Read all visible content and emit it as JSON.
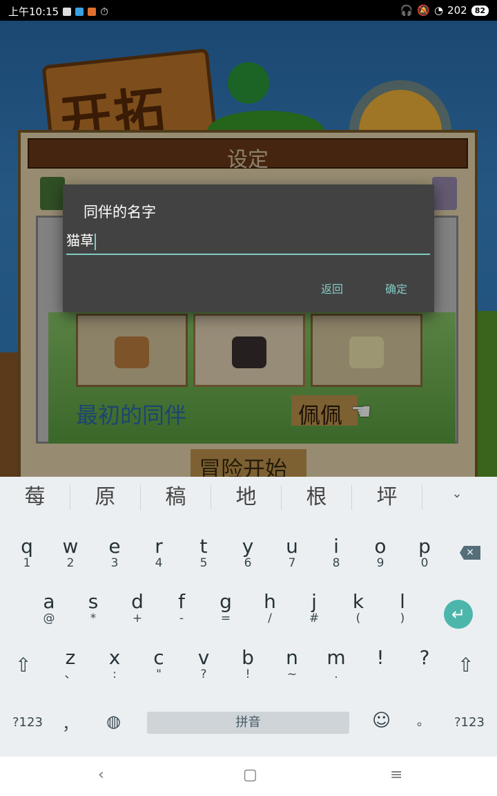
{
  "status_bar": {
    "time": "上午10:15",
    "signal_label": "202",
    "battery": "82"
  },
  "game": {
    "logo_text": "开拓",
    "panel_title": "设定",
    "companion_label": "最初的同伴",
    "companion_name": "佩佩",
    "start_button": "冒险开始"
  },
  "dialog": {
    "title": "同伴的名字",
    "input_value": "猫草",
    "back_label": "返回",
    "ok_label": "确定"
  },
  "keyboard": {
    "candidates": [
      "莓",
      "原",
      "稿",
      "地",
      "根",
      "坪"
    ],
    "row1": [
      {
        "m": "q",
        "s": "1"
      },
      {
        "m": "w",
        "s": "2"
      },
      {
        "m": "e",
        "s": "3"
      },
      {
        "m": "r",
        "s": "4"
      },
      {
        "m": "t",
        "s": "5"
      },
      {
        "m": "y",
        "s": "6"
      },
      {
        "m": "u",
        "s": "7"
      },
      {
        "m": "i",
        "s": "8"
      },
      {
        "m": "o",
        "s": "9"
      },
      {
        "m": "p",
        "s": "0"
      }
    ],
    "row2": [
      {
        "m": "a",
        "s": "@"
      },
      {
        "m": "s",
        "s": "*"
      },
      {
        "m": "d",
        "s": "+"
      },
      {
        "m": "f",
        "s": "-"
      },
      {
        "m": "g",
        "s": "="
      },
      {
        "m": "h",
        "s": "/"
      },
      {
        "m": "j",
        "s": "#"
      },
      {
        "m": "k",
        "s": "("
      },
      {
        "m": "l",
        "s": ")"
      }
    ],
    "row3": [
      {
        "m": "z",
        "s": "、"
      },
      {
        "m": "x",
        "s": ":"
      },
      {
        "m": "c",
        "s": "\""
      },
      {
        "m": "v",
        "s": "?"
      },
      {
        "m": "b",
        "s": "!"
      },
      {
        "m": "n",
        "s": "~"
      },
      {
        "m": "m",
        "s": "."
      },
      {
        "m": "!",
        "s": ""
      },
      {
        "m": "?",
        "s": ""
      }
    ],
    "sym_left": "?123",
    "comma": "，",
    "space_label": "拼音",
    "period": "。",
    "sym_right": "?123"
  },
  "colors": {
    "accent": "#80cbc4",
    "enter_key": "#4db6ac",
    "dialog_bg": "#424242"
  }
}
